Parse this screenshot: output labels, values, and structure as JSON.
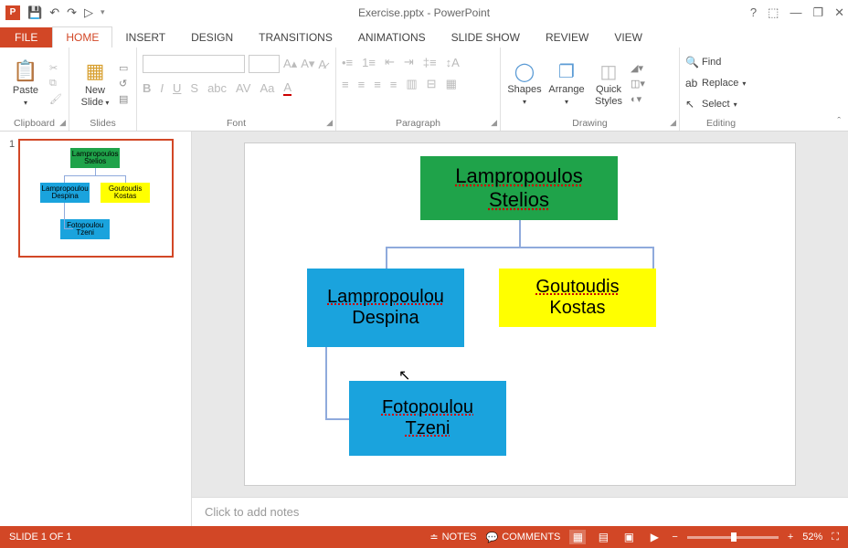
{
  "app": {
    "title": "Exercise.pptx - PowerPoint",
    "icon_letter": "P"
  },
  "qat": {
    "save": "💾",
    "undo": "↶",
    "redo": "↷",
    "start": "▷",
    "more": "▾"
  },
  "wincontrols": {
    "help": "?",
    "display": "⬚",
    "min": "—",
    "restore": "❐",
    "close": "✕"
  },
  "tabs": {
    "file": "FILE",
    "home": "HOME",
    "insert": "INSERT",
    "design": "DESIGN",
    "transitions": "TRANSITIONS",
    "animations": "ANIMATIONS",
    "slideshow": "SLIDE SHOW",
    "review": "REVIEW",
    "view": "VIEW"
  },
  "ribbon": {
    "clipboard": {
      "label": "Clipboard",
      "paste": "Paste",
      "paste_icon": "📋",
      "cut": "✂",
      "copy": "⧉",
      "painter": "🖌"
    },
    "slides": {
      "label": "Slides",
      "new": "New\nSlide",
      "new_icon": "▦",
      "layout": "▭",
      "reset": "↺",
      "section": "▤"
    },
    "font": {
      "label": "Font"
    },
    "paragraph": {
      "label": "Paragraph"
    },
    "drawing": {
      "label": "Drawing",
      "shapes": "Shapes",
      "arrange": "Arrange",
      "quick": "Quick\nStyles"
    },
    "editing": {
      "label": "Editing",
      "find": "Find",
      "replace": "Replace",
      "select": "Select"
    }
  },
  "org": {
    "root": {
      "line1": "Lampropoulos",
      "line2": "Stelios"
    },
    "left": {
      "line1": "Lampropoulou",
      "line2": "Despina"
    },
    "right": {
      "line1": "Goutoudis",
      "line2": "Kostas"
    },
    "child": {
      "line1": "Fotopoulou",
      "line2": "Tzeni"
    }
  },
  "colors": {
    "green": "#1fa34a",
    "blue": "#1aa3dd",
    "yellow": "#ffff00"
  },
  "thumb": {
    "number": "1"
  },
  "notes": {
    "placeholder": "Click to add notes"
  },
  "status": {
    "slide_info": "SLIDE 1 OF 1",
    "notes": "NOTES",
    "comments": "COMMENTS",
    "zoom_label": "52%",
    "minus": "−",
    "plus": "+",
    "fit": "⛶"
  }
}
